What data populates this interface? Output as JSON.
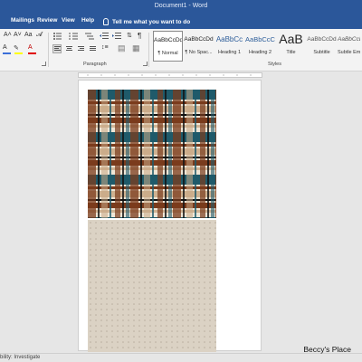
{
  "window": {
    "title": "Document1 - Word"
  },
  "menu": {
    "tabs": [
      "Mailings",
      "Review",
      "View",
      "Help"
    ],
    "tell_me": "Tell me what you want to do"
  },
  "ribbon": {
    "groups": {
      "paragraph": "Paragraph",
      "styles": "Styles"
    },
    "styles": [
      {
        "sample": "AaBbCcDd",
        "name": "¶ Normal"
      },
      {
        "sample": "AaBbCcDd",
        "name": "¶ No Spac..."
      },
      {
        "sample": "AaBbCc",
        "name": "Heading 1"
      },
      {
        "sample": "AaBbCcC",
        "name": "Heading 2"
      },
      {
        "sample": "AaB",
        "name": "Title"
      },
      {
        "sample": "AaBbCcDd",
        "name": "Subtitle"
      },
      {
        "sample": "AaBbCcDd",
        "name": "Subtle Em..."
      }
    ]
  },
  "statusbar": {
    "text": "bility: Investigate"
  },
  "watermark": "Beccy's Place",
  "colors": {
    "title_bar": "#2b579a",
    "plaid_teal": "#1f5a6a",
    "plaid_brown": "#7a3b1c",
    "plaid_tan": "#c8a884",
    "plaid_cream": "#efe6d6",
    "dot_background": "#dbd2c4",
    "dot": "#b8ad9e"
  }
}
